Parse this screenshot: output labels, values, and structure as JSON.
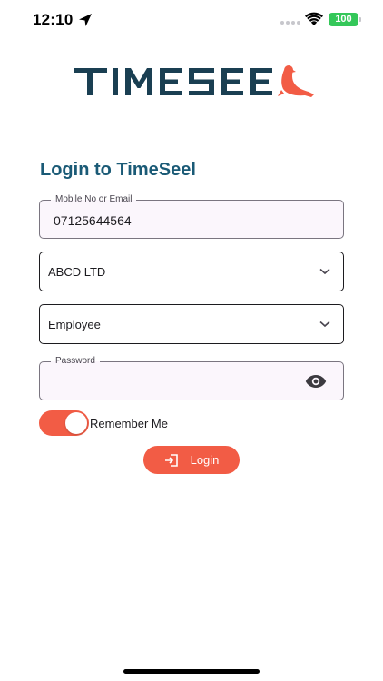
{
  "status_bar": {
    "time": "12:10",
    "battery": "100",
    "icons": [
      "location-arrow-icon",
      "signal-icon",
      "wifi-icon",
      "battery-icon"
    ]
  },
  "brand": {
    "logo_text": "TIMESEEL",
    "logo_mark": "seal-icon",
    "colors": {
      "logo_dark": "#1a3f52",
      "title": "#1a5a76",
      "accent": "#f25c45"
    }
  },
  "form": {
    "title": "Login to TimeSeel",
    "mobile": {
      "label": "Mobile No or Email",
      "value": "07125644564"
    },
    "company": {
      "value": "ABCD LTD",
      "icon": "chevron-down-icon"
    },
    "role": {
      "value": "Employee",
      "icon": "chevron-down-icon"
    },
    "password": {
      "label": "Password",
      "value": "",
      "icon": "eye-icon"
    },
    "remember": {
      "label": "Remember Me",
      "on": true
    },
    "login_button": {
      "label": "Login",
      "icon": "login-icon"
    }
  }
}
